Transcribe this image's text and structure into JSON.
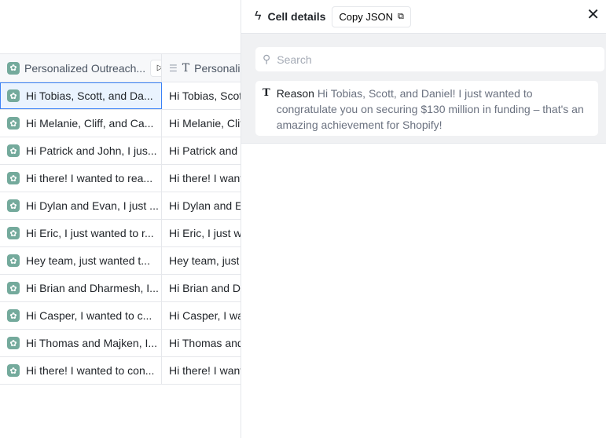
{
  "grid": {
    "columns": [
      {
        "label": "Personalized Outreach..."
      },
      {
        "label": "Personalized Outreach"
      }
    ],
    "rows": [
      [
        "Hi Tobias, Scott, and Da...",
        "Hi Tobias, Scott"
      ],
      [
        "Hi Melanie, Cliff, and Ca...",
        "Hi Melanie, Cliff"
      ],
      [
        "Hi Patrick and John, I jus...",
        "Hi Patrick and J"
      ],
      [
        "Hi there! I wanted to rea...",
        "Hi there! I want"
      ],
      [
        "Hi Dylan and Evan, I just ...",
        "Hi Dylan and E"
      ],
      [
        "Hi Eric, I just wanted to r...",
        "Hi Eric, I just wa"
      ],
      [
        "Hey team, just wanted t...",
        "Hey team, just"
      ],
      [
        "Hi Brian and Dharmesh, I...",
        "Hi Brian and Dh"
      ],
      [
        "Hi Casper, I wanted to c...",
        "Hi Casper, I wa"
      ],
      [
        "Hi Thomas and Majken, I...",
        "Hi Thomas and"
      ],
      [
        "Hi there! I wanted to con...",
        "Hi there! I want"
      ]
    ]
  },
  "panel": {
    "title": "Cell details",
    "copy_label": "Copy JSON",
    "close": "✕",
    "search_placeholder": "Search",
    "field": {
      "key": "Reason",
      "value": "Hi Tobias, Scott, and Daniel! I just wanted to congratulate you on securing $130 million in funding – that's an amazing achievement for Shopify!"
    }
  }
}
